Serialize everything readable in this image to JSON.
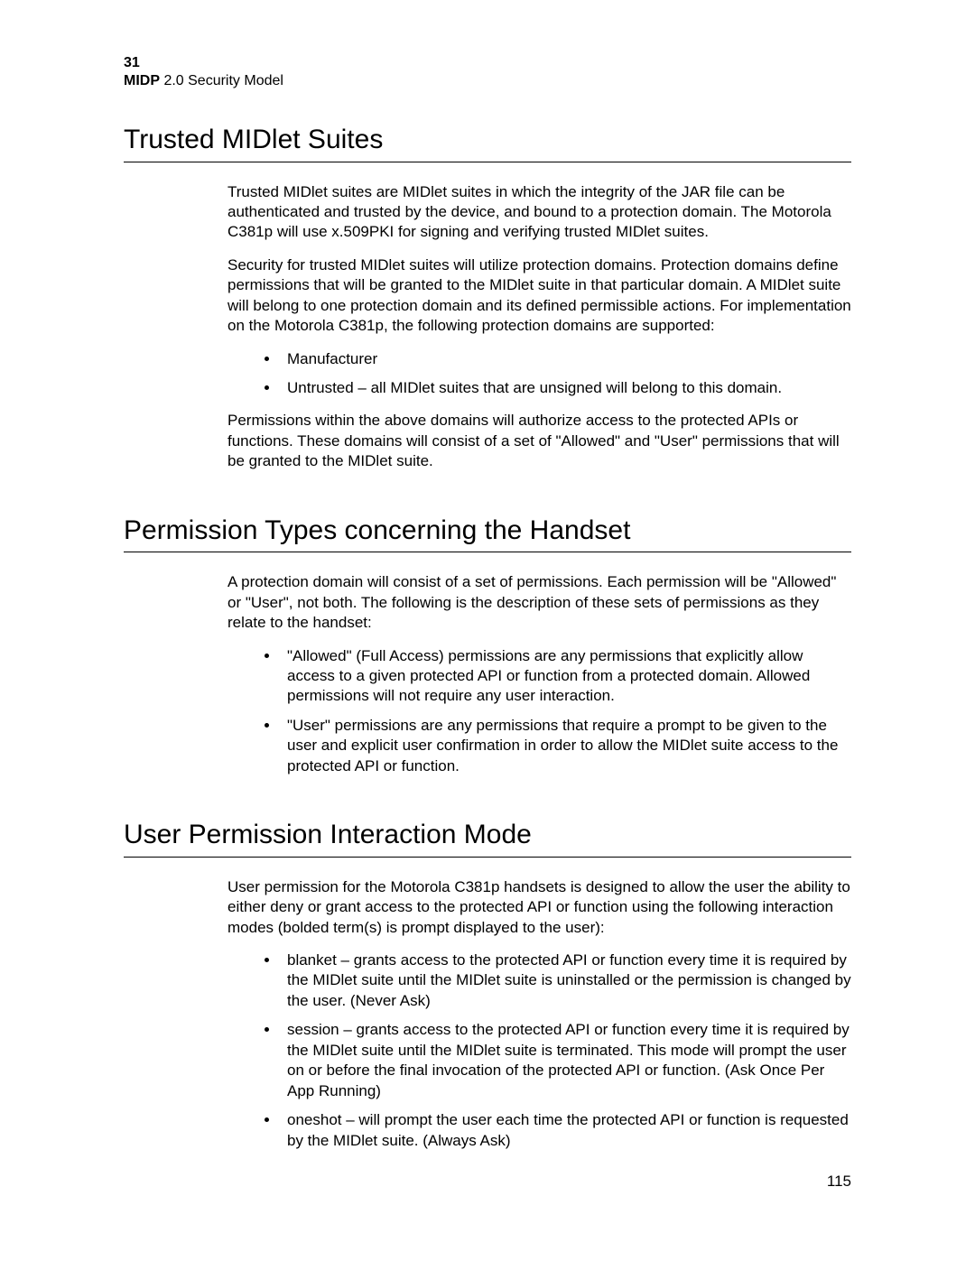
{
  "header": {
    "chapter": "31",
    "title_bold": "MIDP",
    "title_rest": " 2.0 Security Model"
  },
  "sections": {
    "s1": {
      "heading": "Trusted MIDlet Suites",
      "p1": "Trusted MIDlet suites are MIDlet suites in which the integrity of the JAR file can be authenticated and trusted by the device, and bound to a protection domain. The Motorola C381p will use x.509PKI for signing and verifying trusted MIDlet suites.",
      "p2": "Security for trusted MIDlet suites will utilize protection domains. Protection domains define permissions that will be granted to the MIDlet suite in that particular domain. A MIDlet suite will belong to one protection domain and its defined permissible actions. For implementation on the Motorola C381p, the following protection domains are supported:",
      "list": {
        "i1": "Manufacturer",
        "i2": "Untrusted – all MIDlet suites that are unsigned will belong to this domain."
      },
      "p3": "Permissions within the above domains will authorize access to the protected APIs or functions. These domains will consist of a set of \"Allowed\" and \"User\" permissions that will be granted to the MIDlet suite."
    },
    "s2": {
      "heading": "Permission Types concerning the Handset",
      "p1": "A protection domain will consist of a set of permissions. Each permission will be \"Allowed\" or \"User\", not both. The following is the description of these sets of permissions as they relate to the handset:",
      "list": {
        "i1": "\"Allowed\" (Full Access) permissions are any permissions that explicitly allow access to a given protected API or function from a protected domain. Allowed permissions will not require any user interaction.",
        "i2": "\"User\" permissions are any permissions that require a prompt to be given to the user and explicit user confirmation in order to allow the MIDlet suite access to the protected API or function."
      }
    },
    "s3": {
      "heading": "User Permission Interaction Mode",
      "p1": "User permission for the Motorola C381p handsets is designed to allow the user the ability to either deny or grant access to the protected API or function using the following interaction modes (bolded term(s) is prompt displayed to the user):",
      "list": {
        "i1": "blanket – grants access to the protected API or function every time it is required by the MIDlet suite until the MIDlet suite is uninstalled or the permission is changed by the user. (Never Ask)",
        "i2": "session – grants access to the protected API or function every time it is required by the MIDlet suite until the MIDlet suite is terminated. This mode will prompt the user on or before the final invocation of the protected API or function.  (Ask Once Per App Running)",
        "i3": "oneshot – will prompt the user each time the protected API or function is requested by the MIDlet suite. (Always Ask)"
      }
    }
  },
  "page_number": "115"
}
